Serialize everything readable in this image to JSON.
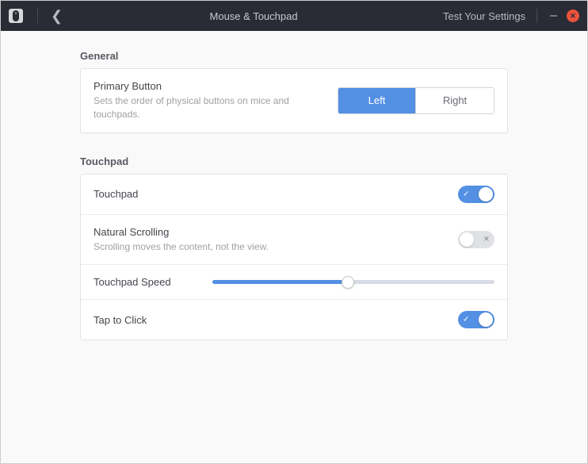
{
  "titlebar": {
    "title": "Mouse & Touchpad",
    "test_link": "Test Your Settings"
  },
  "general": {
    "title": "General",
    "primary_button": {
      "label": "Primary Button",
      "desc": "Sets the order of physical buttons on mice and touchpads.",
      "options": {
        "left": "Left",
        "right": "Right"
      },
      "selected": "left"
    }
  },
  "touchpad": {
    "title": "Touchpad",
    "rows": {
      "touchpad": {
        "label": "Touchpad",
        "enabled": true
      },
      "natural_scrolling": {
        "label": "Natural Scrolling",
        "desc": "Scrolling moves the content, not the view.",
        "enabled": false
      },
      "speed": {
        "label": "Touchpad Speed",
        "value": 48
      },
      "tap_to_click": {
        "label": "Tap to Click",
        "enabled": true
      }
    }
  }
}
